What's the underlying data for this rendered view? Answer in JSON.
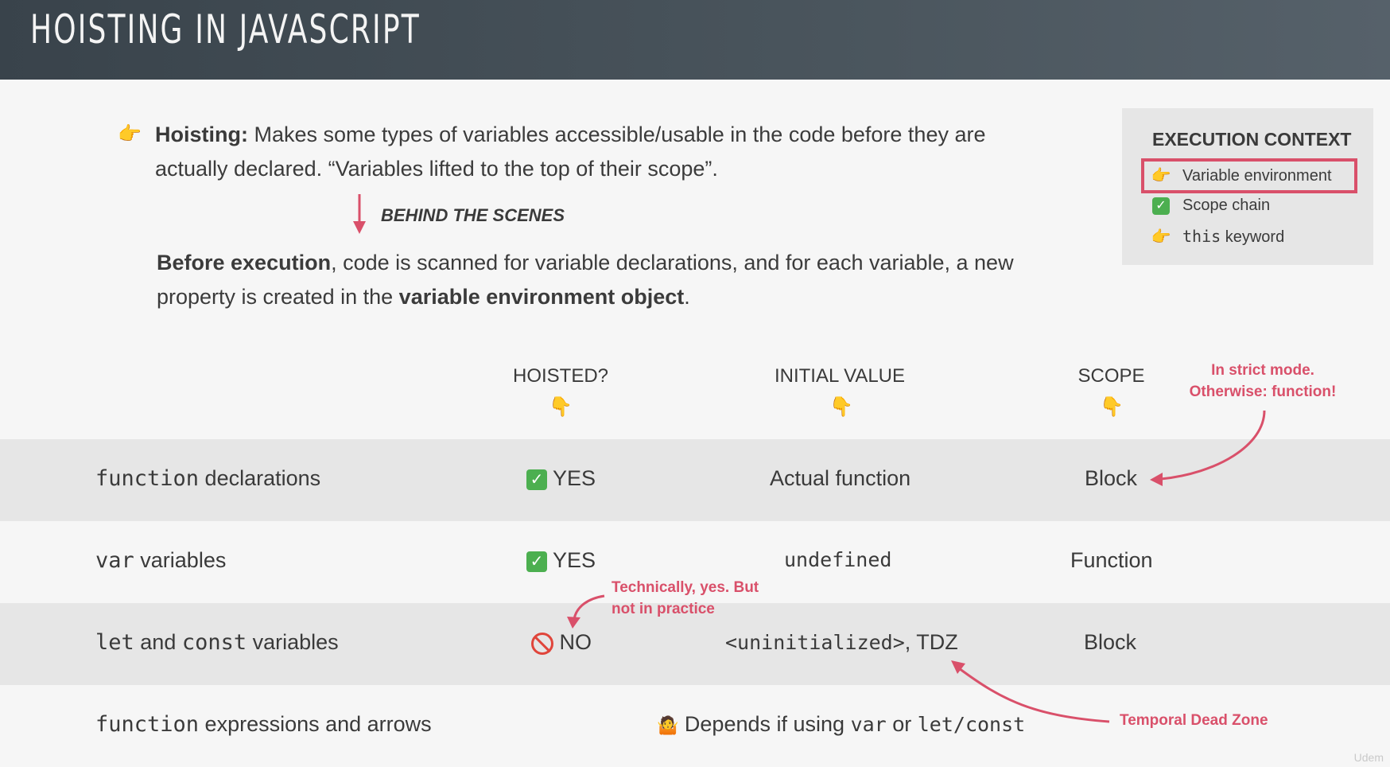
{
  "slide": {
    "title": "HOISTING IN JAVASCRIPT",
    "definition": {
      "term": "Hoisting:",
      "text_line1": " Makes some types of variables accessible/usable in the code before they are",
      "text_line2": "actually declared. “Variables lifted to the top of their scope”."
    },
    "behind_the_scenes": "BEHIND THE SCENES",
    "before": {
      "bold1": "Before execution",
      "text1": ", code is scanned for variable declarations, and for each variable, a new",
      "text2": "property is created in the ",
      "bold2": "variable environment object",
      "text3": "."
    },
    "execution_context": {
      "title": "EXECUTION CONTEXT",
      "items": [
        {
          "icon": "pointing-right-icon",
          "label": "Variable environment",
          "highlighted": true
        },
        {
          "icon": "check-icon",
          "label": "Scope chain"
        },
        {
          "icon": "pointing-right-icon",
          "code": "this",
          "label": " keyword"
        }
      ]
    },
    "table": {
      "headers": [
        "HOISTED?",
        "INITIAL VALUE",
        "SCOPE"
      ],
      "rows": [
        {
          "code": "function",
          "label": " declarations",
          "hoisted": "YES",
          "initial": "Actual function",
          "scope": "Block"
        },
        {
          "code": "var",
          "label": " variables",
          "hoisted": "YES",
          "initial_code": "undefined",
          "scope": "Function"
        },
        {
          "code1": "let",
          "mid": " and ",
          "code2": "const",
          "label": " variables",
          "hoisted": "NO",
          "initial_code": "<uninitialized>",
          "initial_suffix": ", TDZ",
          "scope": "Block"
        },
        {
          "code": "function",
          "label": " expressions and arrows",
          "depends": "Depends if using ",
          "depends_code1": "var",
          "depends_or": " or ",
          "depends_code2": "let/const"
        }
      ]
    },
    "notes": {
      "strict_line1": "In strict mode.",
      "strict_line2": "Otherwise: function!",
      "technically_line1": "Technically, yes. But",
      "technically_line2": "not in practice",
      "tdz": "Temporal Dead Zone"
    },
    "watermark": "Udem"
  },
  "colors": {
    "accent": "#d9506a",
    "header_bg": "#3f4a52",
    "row_shade": "#e6e6e6",
    "check": "#4caf50"
  }
}
